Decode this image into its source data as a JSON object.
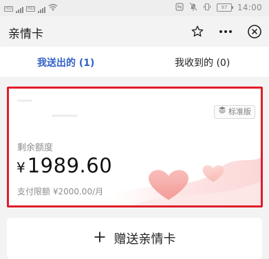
{
  "status_bar": {
    "hd_label": "HD",
    "network_label": "4G",
    "battery": "97",
    "time": "14:00"
  },
  "nav": {
    "title": "亲情卡",
    "actions": [
      "star-icon",
      "more-icon",
      "close-icon"
    ]
  },
  "tabs": [
    {
      "label": "我送出的 (1)",
      "active": true
    },
    {
      "label": "我收到的 (0)",
      "active": false
    }
  ],
  "card": {
    "badge_label": "标准版",
    "balance_label": "剩余额度",
    "currency": "¥",
    "balance": "1989.60",
    "limit_text": "支付限额 ¥2000.00/月"
  },
  "gift_button": {
    "label": "赠送亲情卡",
    "icon": "plus-icon"
  },
  "colors": {
    "accent_tab": "#3161c9",
    "highlight_border": "#e01c2a",
    "background": "#f3f3f3"
  }
}
